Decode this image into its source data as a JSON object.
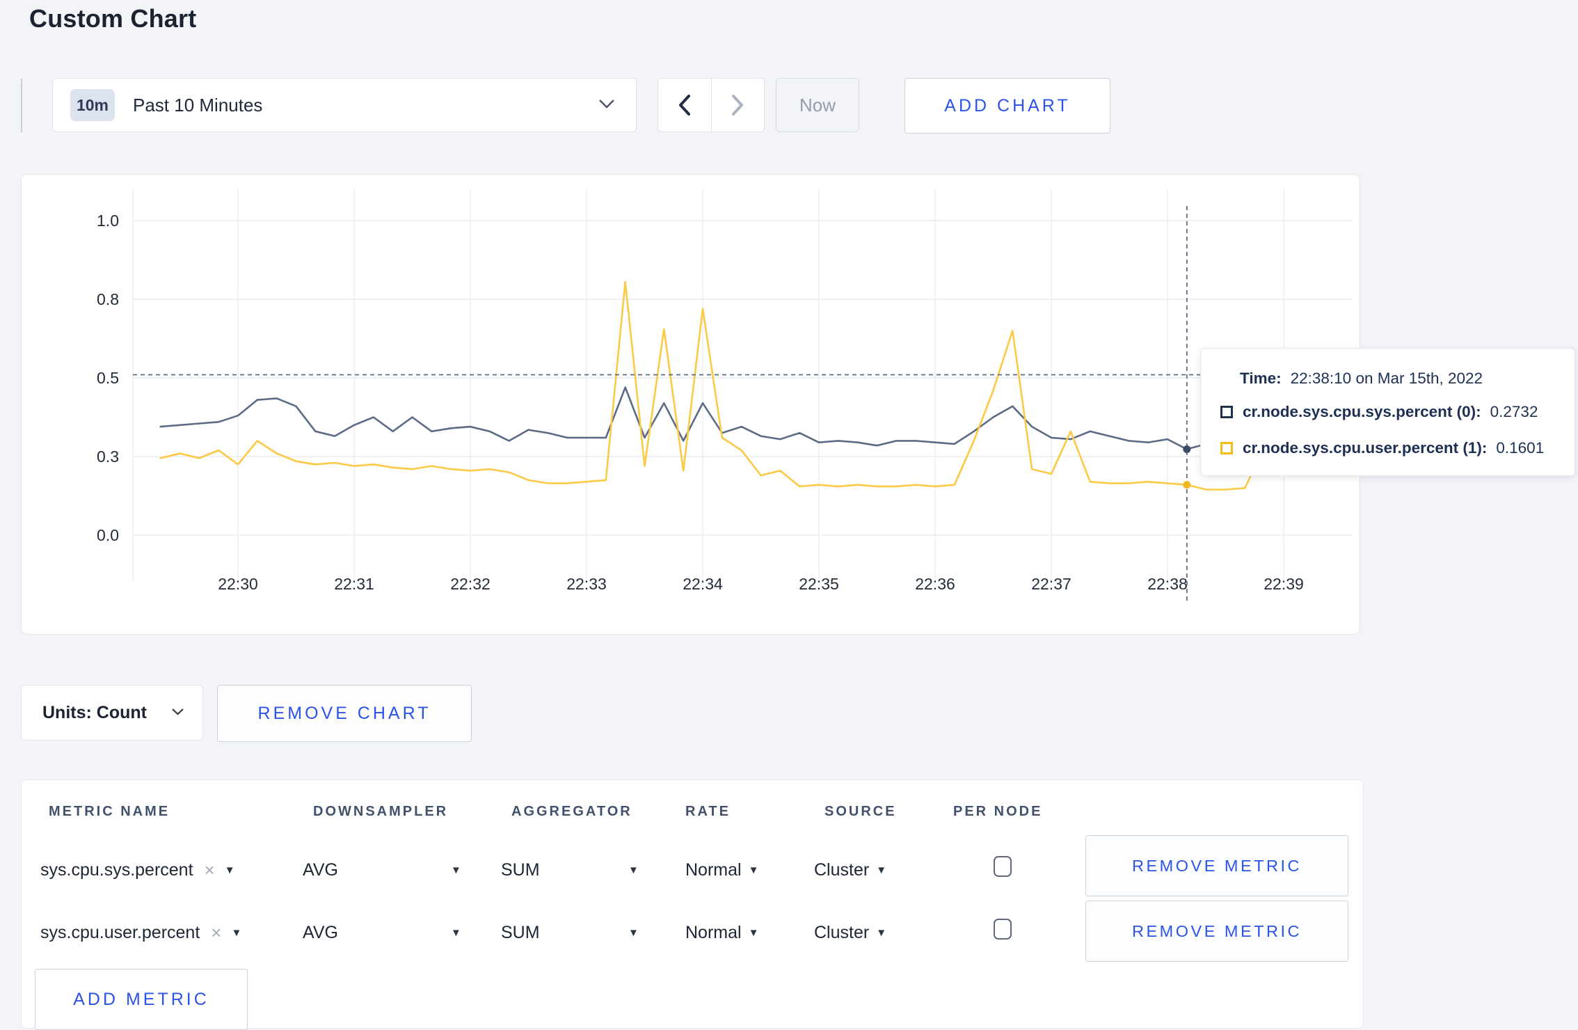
{
  "page": {
    "title": "Custom Chart"
  },
  "toolbar": {
    "time_window_badge": "10m",
    "time_window_label": "Past 10 Minutes",
    "now_label": "Now",
    "add_chart_label": "ADD CHART"
  },
  "chart": {
    "units_label": "Units: Count",
    "remove_chart_label": "REMOVE CHART",
    "crosshair": {
      "time_index": 53,
      "mouse_value": 0.51
    },
    "tooltip": {
      "time_label": "Time:",
      "time_value": "22:38:10 on Mar 15th, 2022",
      "series": [
        {
          "name": "cr.node.sys.cpu.sys.percent (0):",
          "value": "0.2732",
          "color": "#22334f"
        },
        {
          "name": "cr.node.sys.cpu.user.percent (1):",
          "value": "0.1601",
          "color": "#f5bd13"
        }
      ]
    }
  },
  "chart_data": {
    "type": "line",
    "title": "",
    "xlabel": "",
    "ylabel": "",
    "ylim": [
      0,
      1
    ],
    "grid": true,
    "legend_position": "none",
    "y_ticks": {
      "positions": [
        0,
        0.25,
        0.5,
        0.75,
        1.0
      ],
      "labels": [
        "0.0",
        "0.3",
        "0.5",
        "0.8",
        "1.0"
      ]
    },
    "x_tick_labels": [
      "22:30",
      "22:31",
      "22:32",
      "22:33",
      "22:34",
      "22:35",
      "22:36",
      "22:37",
      "22:38",
      "22:39"
    ],
    "x": [
      "22:29:20",
      "22:29:30",
      "22:29:40",
      "22:29:50",
      "22:30:00",
      "22:30:10",
      "22:30:20",
      "22:30:30",
      "22:30:40",
      "22:30:50",
      "22:31:00",
      "22:31:10",
      "22:31:20",
      "22:31:30",
      "22:31:40",
      "22:31:50",
      "22:32:00",
      "22:32:10",
      "22:32:20",
      "22:32:30",
      "22:32:40",
      "22:32:50",
      "22:33:00",
      "22:33:10",
      "22:33:20",
      "22:33:30",
      "22:33:40",
      "22:33:50",
      "22:34:00",
      "22:34:10",
      "22:34:20",
      "22:34:30",
      "22:34:40",
      "22:34:50",
      "22:35:00",
      "22:35:10",
      "22:35:20",
      "22:35:30",
      "22:35:40",
      "22:35:50",
      "22:36:00",
      "22:36:10",
      "22:36:20",
      "22:36:30",
      "22:36:40",
      "22:36:50",
      "22:37:00",
      "22:37:10",
      "22:37:20",
      "22:37:30",
      "22:37:40",
      "22:37:50",
      "22:38:00",
      "22:38:10",
      "22:38:20",
      "22:38:30",
      "22:38:40",
      "22:38:50",
      "22:39:00",
      "22:39:10"
    ],
    "series": [
      {
        "name": "cr.node.sys.cpu.sys.percent",
        "color": "#5b6b85",
        "values": [
          0.345,
          0.35,
          0.355,
          0.36,
          0.38,
          0.43,
          0.435,
          0.41,
          0.33,
          0.315,
          0.35,
          0.375,
          0.33,
          0.375,
          0.33,
          0.34,
          0.345,
          0.33,
          0.3,
          0.335,
          0.325,
          0.31,
          0.31,
          0.31,
          0.47,
          0.31,
          0.42,
          0.3,
          0.42,
          0.325,
          0.345,
          0.315,
          0.305,
          0.325,
          0.295,
          0.3,
          0.295,
          0.285,
          0.3,
          0.3,
          0.295,
          0.29,
          0.33,
          0.375,
          0.41,
          0.345,
          0.31,
          0.305,
          0.33,
          0.315,
          0.3,
          0.295,
          0.305,
          0.2732,
          0.29,
          0.3,
          0.295,
          0.3,
          0.31,
          0.3
        ]
      },
      {
        "name": "cr.node.sys.cpu.user.percent",
        "color": "#fcc944",
        "values": [
          0.245,
          0.26,
          0.245,
          0.27,
          0.225,
          0.3,
          0.26,
          0.235,
          0.225,
          0.23,
          0.22,
          0.225,
          0.215,
          0.21,
          0.22,
          0.21,
          0.205,
          0.21,
          0.2,
          0.175,
          0.165,
          0.165,
          0.17,
          0.175,
          0.805,
          0.22,
          0.655,
          0.205,
          0.72,
          0.31,
          0.27,
          0.19,
          0.205,
          0.155,
          0.16,
          0.155,
          0.16,
          0.155,
          0.155,
          0.16,
          0.155,
          0.16,
          0.3,
          0.46,
          0.65,
          0.21,
          0.195,
          0.33,
          0.17,
          0.165,
          0.165,
          0.17,
          0.165,
          0.1601,
          0.145,
          0.145,
          0.15,
          0.28,
          0.22,
          0.27
        ]
      }
    ]
  },
  "metrics_table": {
    "columns": [
      "METRIC NAME",
      "DOWNSAMPLER",
      "AGGREGATOR",
      "RATE",
      "SOURCE",
      "PER NODE"
    ],
    "rows": [
      {
        "metric_name": "sys.cpu.sys.percent",
        "downsampler": "AVG",
        "aggregator": "SUM",
        "rate": "Normal",
        "source": "Cluster",
        "per_node_checked": false,
        "remove_label": "REMOVE METRIC"
      },
      {
        "metric_name": "sys.cpu.user.percent",
        "downsampler": "AVG",
        "aggregator": "SUM",
        "rate": "Normal",
        "source": "Cluster",
        "per_node_checked": false,
        "remove_label": "REMOVE METRIC"
      }
    ],
    "add_metric_label": "ADD METRIC"
  }
}
